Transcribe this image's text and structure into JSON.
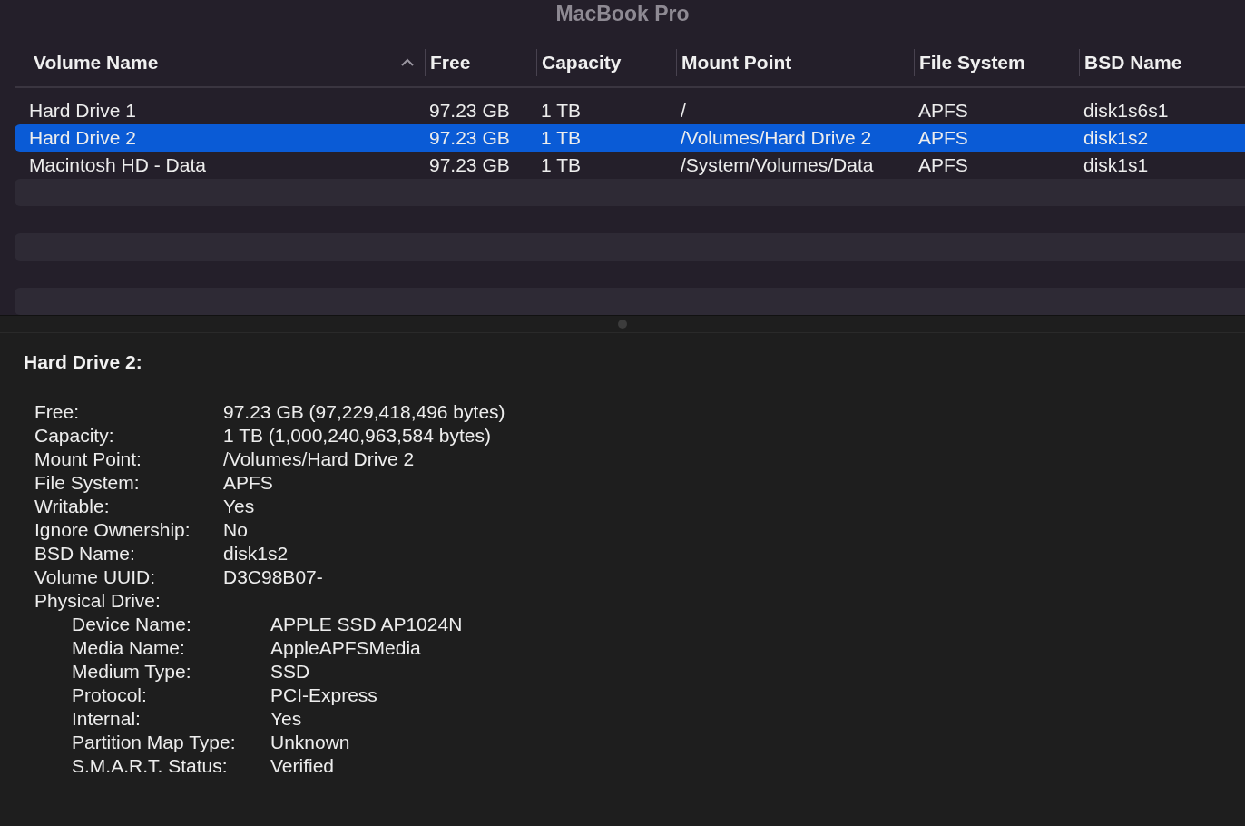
{
  "window": {
    "title": "MacBook Pro"
  },
  "table": {
    "columns": [
      {
        "label": "Volume Name",
        "sorted": true
      },
      {
        "label": "Free",
        "sorted": false
      },
      {
        "label": "Capacity",
        "sorted": false
      },
      {
        "label": "Mount Point",
        "sorted": false
      },
      {
        "label": "File System",
        "sorted": false
      },
      {
        "label": "BSD Name",
        "sorted": false
      }
    ],
    "rows": [
      {
        "cells": [
          "Hard Drive 1",
          "97.23 GB",
          "1 TB",
          "/",
          "APFS",
          "disk1s6s1"
        ],
        "selected": false
      },
      {
        "cells": [
          "Hard Drive 2",
          "97.23 GB",
          "1 TB",
          "/Volumes/Hard Drive 2",
          "APFS",
          "disk1s2"
        ],
        "selected": true
      },
      {
        "cells": [
          "Macintosh HD - Data",
          "97.23 GB",
          "1 TB",
          "/System/Volumes/Data",
          "APFS",
          "disk1s1"
        ],
        "selected": false
      }
    ]
  },
  "details": {
    "title": "Hard Drive 2:",
    "properties": [
      {
        "label": "Free:",
        "value": "97.23 GB (97,229,418,496 bytes)"
      },
      {
        "label": "Capacity:",
        "value": "1 TB (1,000,240,963,584 bytes)"
      },
      {
        "label": "Mount Point:",
        "value": "/Volumes/Hard Drive 2"
      },
      {
        "label": "File System:",
        "value": "APFS"
      },
      {
        "label": "Writable:",
        "value": "Yes"
      },
      {
        "label": "Ignore Ownership:",
        "value": "No"
      },
      {
        "label": "BSD Name:",
        "value": "disk1s2"
      },
      {
        "label": "Volume UUID:",
        "value": "D3C98B07-"
      },
      {
        "label": "Physical Drive:",
        "children": [
          {
            "label": "Device Name:",
            "value": "APPLE SSD AP1024N"
          },
          {
            "label": "Media Name:",
            "value": "AppleAPFSMedia"
          },
          {
            "label": "Medium Type:",
            "value": "SSD"
          },
          {
            "label": "Protocol:",
            "value": "PCI-Express"
          },
          {
            "label": "Internal:",
            "value": "Yes"
          },
          {
            "label": "Partition Map Type:",
            "value": "Unknown"
          },
          {
            "label": "S.M.A.R.T. Status:",
            "value": "Verified"
          }
        ]
      }
    ]
  }
}
